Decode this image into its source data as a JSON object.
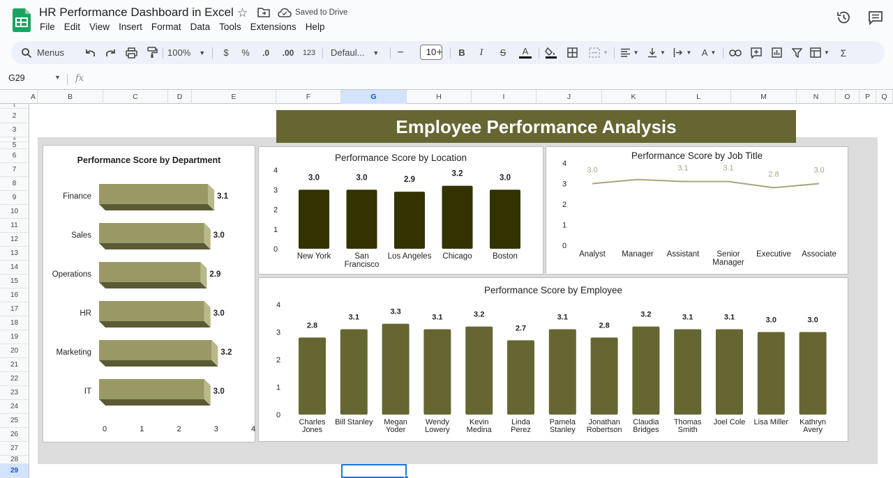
{
  "app": {
    "doc_title": "HR Performance Dashboard in Excel",
    "saved_status": "Saved to Drive",
    "menu": [
      "File",
      "Edit",
      "View",
      "Insert",
      "Format",
      "Data",
      "Tools",
      "Extensions",
      "Help"
    ]
  },
  "toolbar": {
    "menus_label": "Menus",
    "zoom": "100%",
    "currency": "$",
    "percent": "%",
    "decrease_decimal": ".0",
    "increase_decimal": ".00",
    "number_format": "123",
    "font_family": "Defaul...",
    "font_size": "10",
    "bold": "B",
    "italic": "I",
    "strikethrough": "S",
    "text_color": "A",
    "text_rotation": "A",
    "functions": "Σ"
  },
  "formula_bar": {
    "name_box": "G29",
    "fx": "fx",
    "value": ""
  },
  "grid": {
    "columns": [
      "A",
      "B",
      "C",
      "D",
      "E",
      "F",
      "G",
      "H",
      "I",
      "J",
      "K",
      "L",
      "M",
      "N",
      "O",
      "P",
      "Q"
    ],
    "selected_column": "G",
    "rows": [
      "1",
      "2",
      "3",
      "4",
      "5",
      "6",
      "7",
      "8",
      "9",
      "10",
      "11",
      "12",
      "13",
      "14",
      "15",
      "16",
      "17",
      "18",
      "19",
      "20",
      "21",
      "22",
      "23",
      "24",
      "25",
      "26",
      "27",
      "28",
      "29"
    ],
    "selected_row": "29"
  },
  "dashboard": {
    "title": "Employee Performance Analysis",
    "colors": {
      "title_bg": "#666633",
      "dept_bar": "#999966",
      "location_bar": "#333300",
      "employee_bar": "#666633",
      "line": "#a6a67a"
    }
  },
  "chart_data": [
    {
      "type": "bar",
      "orientation": "horizontal",
      "title": "Performance Score by Department",
      "categories": [
        "Finance",
        "Sales",
        "Operations",
        "HR",
        "Marketing",
        "IT"
      ],
      "values": [
        3.1,
        3.0,
        2.9,
        3.0,
        3.2,
        3.0
      ],
      "ticks": [
        0,
        1,
        2,
        3,
        4
      ],
      "xlim": [
        0,
        4
      ]
    },
    {
      "type": "bar",
      "title": "Performance Score by Location",
      "categories": [
        "New York",
        "San Francisco",
        "Los Angeles",
        "Chicago",
        "Boston"
      ],
      "values": [
        3.0,
        3.0,
        2.9,
        3.2,
        3.0
      ],
      "ticks": [
        0,
        1,
        2,
        3,
        4
      ],
      "ylim": [
        0,
        4
      ]
    },
    {
      "type": "line",
      "title": "Performance Score by Job Title",
      "categories": [
        "Analyst",
        "Manager",
        "Assistant",
        "Senior Manager",
        "Executive",
        "Associate"
      ],
      "values": [
        3.0,
        3.2,
        3.1,
        3.1,
        2.8,
        3.0
      ],
      "labels": [
        "3.0",
        "",
        "3.1",
        "3.1",
        "2.8",
        "3.0"
      ],
      "ticks": [
        0,
        1,
        2,
        3,
        4
      ],
      "ylim": [
        0,
        4
      ]
    },
    {
      "type": "bar",
      "title": "Performance Score by Employee",
      "categories": [
        "Charles Jones",
        "Bill Stanley",
        "Megan Yoder",
        "Wendy Lowery",
        "Kevin Medina",
        "Linda Perez",
        "Pamela Stanley",
        "Jonathan Robertson",
        "Claudia Bridges",
        "Thomas Smith",
        "Joel Cole",
        "Lisa Miller",
        "Kathryn Avery"
      ],
      "values": [
        2.8,
        3.1,
        3.3,
        3.1,
        3.2,
        2.7,
        3.1,
        2.8,
        3.2,
        3.1,
        3.1,
        3.0,
        3.0
      ],
      "ticks": [
        0,
        1,
        2,
        3,
        4
      ],
      "ylim": [
        0,
        4
      ]
    }
  ]
}
